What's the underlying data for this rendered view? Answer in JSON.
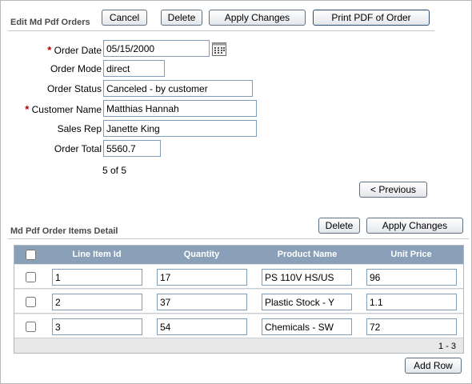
{
  "master": {
    "title": "Edit Md Pdf Orders",
    "buttons": {
      "cancel": "Cancel",
      "delete": "Delete",
      "apply": "Apply Changes",
      "print": "Print PDF of Order"
    },
    "fields": {
      "order_date": {
        "label": "Order Date",
        "value": "05/15/2000",
        "required": true
      },
      "order_mode": {
        "label": "Order Mode",
        "value": "direct"
      },
      "order_status": {
        "label": "Order Status",
        "value": "Canceled - by customer"
      },
      "customer_name": {
        "label": "Customer Name",
        "value": "Matthias Hannah",
        "required": true
      },
      "sales_rep": {
        "label": "Sales Rep",
        "value": "Janette King"
      },
      "order_total": {
        "label": "Order Total",
        "value": "5560.7"
      }
    },
    "required_marker": "*",
    "record_counter": "5 of 5",
    "previous_button": "< Previous",
    "calendar_icon": "calendar-icon"
  },
  "detail": {
    "title": "Md Pdf Order Items Detail",
    "buttons": {
      "delete": "Delete",
      "apply": "Apply Changes",
      "add_row": "Add Row"
    },
    "columns": [
      "Line Item Id",
      "Quantity",
      "Product Name",
      "Unit Price"
    ],
    "rows": [
      {
        "line_item_id": "1",
        "quantity": "17",
        "product_name": "PS 110V HS/US",
        "unit_price": "96"
      },
      {
        "line_item_id": "2",
        "quantity": "37",
        "product_name": "Plastic Stock - Y",
        "unit_price": "1.1"
      },
      {
        "line_item_id": "3",
        "quantity": "54",
        "product_name": "Chemicals - SW",
        "unit_price": "72"
      }
    ],
    "pagination": "1 - 3"
  },
  "colors": {
    "header_bg": "#8aa0b8",
    "title_text": "#4a4a4a",
    "required": "#b00000"
  }
}
